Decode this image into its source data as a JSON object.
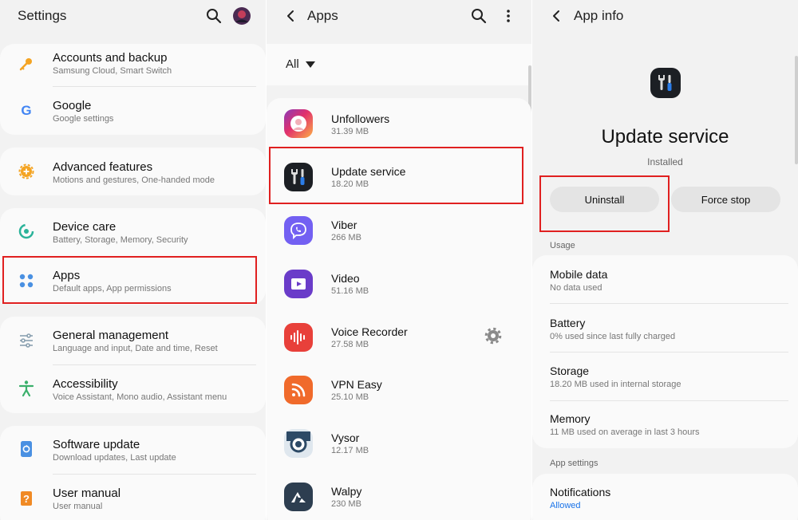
{
  "settings": {
    "title": "Settings",
    "items": [
      {
        "title": "Accounts and backup",
        "subtitle": "Samsung Cloud, Smart Switch",
        "icon": "key-icon"
      },
      {
        "title": "Google",
        "subtitle": "Google settings",
        "icon": "google-icon"
      },
      {
        "title": "Advanced features",
        "subtitle": "Motions and gestures, One-handed mode",
        "icon": "gear-plus-icon"
      },
      {
        "title": "Device care",
        "subtitle": "Battery, Storage, Memory, Security",
        "icon": "device-care-icon"
      },
      {
        "title": "Apps",
        "subtitle": "Default apps, App permissions",
        "icon": "apps-grid-icon"
      },
      {
        "title": "General management",
        "subtitle": "Language and input, Date and time, Reset",
        "icon": "sliders-icon"
      },
      {
        "title": "Accessibility",
        "subtitle": "Voice Assistant, Mono audio, Assistant menu",
        "icon": "accessibility-icon"
      },
      {
        "title": "Software update",
        "subtitle": "Download updates, Last update",
        "icon": "software-update-icon"
      },
      {
        "title": "User manual",
        "subtitle": "User manual",
        "icon": "manual-icon"
      }
    ]
  },
  "apps": {
    "title": "Apps",
    "filter": "All",
    "items": [
      {
        "name": "Unfollowers",
        "size": "31.39 MB",
        "icon": "unfollowers-icon"
      },
      {
        "name": "Update service",
        "size": "18.20 MB",
        "icon": "update-service-icon"
      },
      {
        "name": "Viber",
        "size": "266 MB",
        "icon": "viber-icon"
      },
      {
        "name": "Video",
        "size": "51.16 MB",
        "icon": "video-icon"
      },
      {
        "name": "Voice Recorder",
        "size": "27.58 MB",
        "icon": "voice-recorder-icon"
      },
      {
        "name": "VPN Easy",
        "size": "25.10 MB",
        "icon": "vpn-easy-icon"
      },
      {
        "name": "Vysor",
        "size": "12.17 MB",
        "icon": "vysor-icon"
      },
      {
        "name": "Walpy",
        "size": "230 MB",
        "icon": "walpy-icon"
      }
    ]
  },
  "appinfo": {
    "title": "App info",
    "app_name": "Update service",
    "status": "Installed",
    "uninstall_label": "Uninstall",
    "force_stop_label": "Force stop",
    "usage_header": "Usage",
    "usage": [
      {
        "title": "Mobile data",
        "subtitle": "No data used"
      },
      {
        "title": "Battery",
        "subtitle": "0% used since last fully charged"
      },
      {
        "title": "Storage",
        "subtitle": "18.20 MB used in internal storage"
      },
      {
        "title": "Memory",
        "subtitle": "11 MB used on average in last 3 hours"
      }
    ],
    "app_settings_header": "App settings",
    "notifications": {
      "title": "Notifications",
      "subtitle": "Allowed"
    }
  },
  "colors": {
    "highlight": "#e02020",
    "allowed": "#1a73e8"
  }
}
